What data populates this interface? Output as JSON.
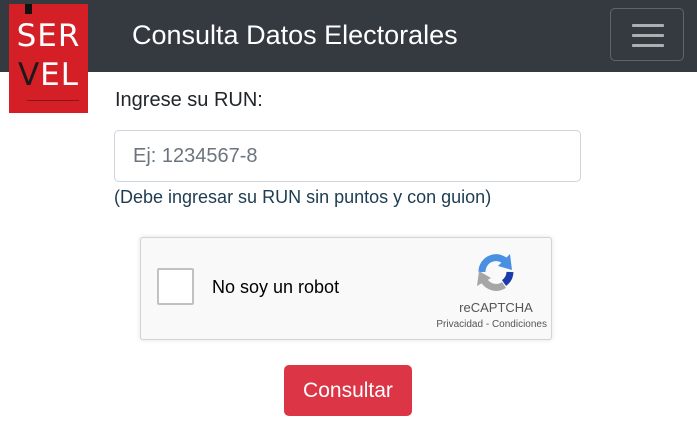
{
  "navbar": {
    "logo_line1": "SER",
    "logo_line2_part1": "V",
    "logo_line2_part2": "EL",
    "title": "Consulta Datos Electorales",
    "toggler_icon": "hamburger-menu-icon"
  },
  "form": {
    "run_label": "Ingrese su RUN:",
    "run_value": "",
    "run_placeholder": "Ej: 1234567-8",
    "help_text": "(Debe ingresar su RUN sin puntos y con guion)",
    "submit_label": "Consultar"
  },
  "captcha": {
    "label": "No soy un robot",
    "brand": "reCAPTCHA",
    "privacy": "Privacidad",
    "separator": " - ",
    "terms": "Condiciones",
    "checked": false,
    "logo_icon": "recaptcha-logo-icon"
  },
  "colors": {
    "navbar_bg": "#343a40",
    "logo_bg": "#d41f26",
    "button_bg": "#dc3545",
    "help_text": "#1d3c52"
  }
}
